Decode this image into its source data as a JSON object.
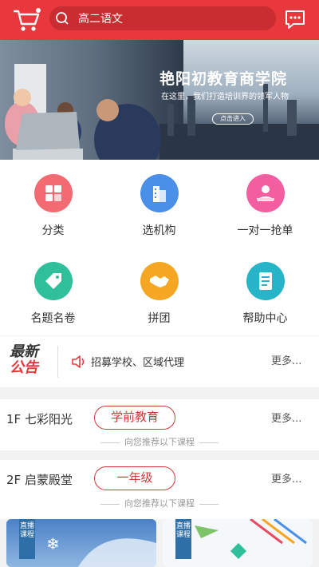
{
  "search": {
    "query": "高二语文"
  },
  "banner": {
    "title": "艳阳初教育商学院",
    "subtitle": "在这里，我们打造培训界的领军人物",
    "button": "点击进入"
  },
  "grid": [
    {
      "label": "分类",
      "icon": "category-icon",
      "color": "#f26b73"
    },
    {
      "label": "选机构",
      "icon": "building-icon",
      "color": "#4a8fe8"
    },
    {
      "label": "一对一抢单",
      "icon": "tutor-icon",
      "color": "#f25e9f"
    },
    {
      "label": "名题名卷",
      "icon": "tag-icon",
      "color": "#2fbf9a"
    },
    {
      "label": "拼团",
      "icon": "handshake-icon",
      "color": "#f5a623"
    },
    {
      "label": "帮助中心",
      "icon": "document-icon",
      "color": "#27b4c9"
    }
  ],
  "notice": {
    "logo_top": "最新",
    "logo_bottom": "公告",
    "text": "招募学校、区域代理",
    "more": "更多..."
  },
  "sections": [
    {
      "title": "1F 七彩阳光",
      "pill": "学前教育",
      "more": "更多...",
      "recommend": "向您推荐以下课程"
    },
    {
      "title": "2F 启蒙殿堂",
      "pill": "一年级",
      "more": "更多...",
      "recommend": "向您推荐以下课程"
    }
  ],
  "cards": [
    {
      "tag": "直播课程"
    },
    {
      "tag": "直播课程"
    }
  ]
}
